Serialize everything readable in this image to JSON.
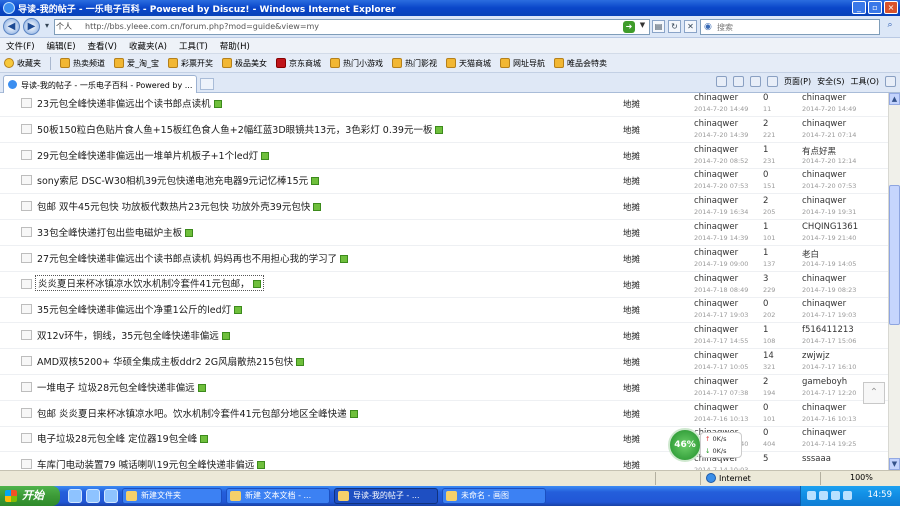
{
  "window": {
    "title": "导读-我的帖子 - 一乐电子百科 - Powered by Discuz! - Windows Internet Explorer"
  },
  "address": {
    "scheme_label": "个人",
    "url": "http://bbs.yleee.com.cn/forum.php?mod=guide&view=my"
  },
  "search": {
    "placeholder": "搜索"
  },
  "menu": [
    "文件(F)",
    "编辑(E)",
    "查看(V)",
    "收藏夹(A)",
    "工具(T)",
    "帮助(H)"
  ],
  "favorites": {
    "label": "收藏夹",
    "items": [
      "热卖频道",
      "爱_淘_宝",
      "彩票开奖",
      "极品美女",
      "京东商城",
      "热门小游戏",
      "热门影视",
      "天猫商城",
      "网址导航",
      "唯品会特卖"
    ]
  },
  "tab": {
    "label": "导读-我的帖子 - 一乐电子百科 - Powered by ..."
  },
  "commands": {
    "page": "页面(P)",
    "safety": "安全(S)",
    "tools": "工具(O)"
  },
  "threads": [
    {
      "title": "23元包全峰快递非偏远出个读书郎点读机",
      "forum": "地摊",
      "author": "chinaqwer",
      "adate": "2014-7-20 14:49",
      "replies": "0",
      "views": "11",
      "lastuser": "chinaqwer",
      "ldate": "2014-7-20 14:49"
    },
    {
      "title": "50板150粒白色贴片食人鱼+15板红色食人鱼+2幅红蓝3D眼镜共13元，3色彩灯 0.39元一板",
      "forum": "地摊",
      "author": "chinaqwer",
      "adate": "2014-7-20 14:39",
      "replies": "2",
      "views": "221",
      "lastuser": "chinaqwer",
      "ldate": "2014-7-21 07:14"
    },
    {
      "title": "29元包全峰快递非偏远出一堆单片机板子+1个led灯",
      "forum": "地摊",
      "author": "chinaqwer",
      "adate": "2014-7-20 08:52",
      "replies": "1",
      "views": "231",
      "lastuser": "有点好黑",
      "ldate": "2014-7-20 12:14"
    },
    {
      "title": "sony索尼 DSC-W30相机39元包快递电池充电器9元记忆棒15元",
      "forum": "地摊",
      "author": "chinaqwer",
      "adate": "2014-7-20 07:53",
      "replies": "0",
      "views": "151",
      "lastuser": "chinaqwer",
      "ldate": "2014-7-20 07:53"
    },
    {
      "title": "包邮 双牛45元包快 功放板代数热片23元包快 功放外壳39元包快",
      "forum": "地摊",
      "author": "chinaqwer",
      "adate": "2014-7-19 16:34",
      "replies": "2",
      "views": "205",
      "lastuser": "chinaqwer",
      "ldate": "2014-7-19 19:31"
    },
    {
      "title": "33包全峰快递打包出些电磁炉主板",
      "forum": "地摊",
      "author": "chinaqwer",
      "adate": "2014-7-19 14:39",
      "replies": "1",
      "views": "101",
      "lastuser": "CHQING1361",
      "ldate": "2014-7-19 21:40"
    },
    {
      "title": "27元包全峰快递非偏远出个读书郎点读机 妈妈再也不用担心我的学习了",
      "forum": "地摊",
      "author": "chinaqwer",
      "adate": "2014-7-19 09:00",
      "replies": "1",
      "views": "137",
      "lastuser": "老白",
      "ldate": "2014-7-19 14:05"
    },
    {
      "title": "炎炎夏日来杯冰镇凉水饮水机制冷套件41元包邮，",
      "forum": "地摊",
      "author": "chinaqwer",
      "adate": "2014-7-18 08:49",
      "replies": "3",
      "views": "229",
      "lastuser": "chinaqwer",
      "ldate": "2014-7-19 08:23"
    },
    {
      "title": "35元包全峰快递非偏远出个净重1公斤的led灯",
      "forum": "地摊",
      "author": "chinaqwer",
      "adate": "2014-7-17 19:03",
      "replies": "0",
      "views": "202",
      "lastuser": "chinaqwer",
      "ldate": "2014-7-17 19:03"
    },
    {
      "title": "双12v环牛，铜线，35元包全峰快递非偏远",
      "forum": "地摊",
      "author": "chinaqwer",
      "adate": "2014-7-17 14:55",
      "replies": "1",
      "views": "108",
      "lastuser": "f516411213",
      "ldate": "2014-7-17 15:06"
    },
    {
      "title": "AMD双核5200+ 华硕全集成主板ddr2 2G风扇散热215包快",
      "forum": "地摊",
      "author": "chinaqwer",
      "adate": "2014-7-17 10:05",
      "replies": "14",
      "views": "321",
      "lastuser": "zwjwjz",
      "ldate": "2014-7-17 16:10"
    },
    {
      "title": "一堆电子 垃圾28元包全峰快递非偏远",
      "forum": "地摊",
      "author": "chinaqwer",
      "adate": "2014-7-17 07:38",
      "replies": "2",
      "views": "194",
      "lastuser": "gameboyh",
      "ldate": "2014-7-17 12:20"
    },
    {
      "title": "包邮 炎炎夏日来杯冰镇凉水吧。饮水机制冷套件41元包部分地区全峰快递",
      "forum": "地摊",
      "author": "chinaqwer",
      "adate": "2014-7-16 10:13",
      "replies": "0",
      "views": "101",
      "lastuser": "chinaqwer",
      "ldate": "2014-7-16 10:13"
    },
    {
      "title": "电子垃圾28元包全峰 定位器19包全峰",
      "forum": "地摊",
      "author": "chinaqwer",
      "adate": "2014-7-16 12:40",
      "replies": "0",
      "views": "404",
      "lastuser": "chinaqwer",
      "ldate": "2014-7-14 19:25"
    },
    {
      "title": "车库门电动装置79 喊话喇叭19元包全峰快递非偏远",
      "forum": "地摊",
      "author": "chinaqwer",
      "adate": "2014-7-14 10:03",
      "replies": "5",
      "views": "",
      "lastuser": "sssaaa",
      "ldate": ""
    }
  ],
  "speed_widget": {
    "percent": "46%",
    "up": "0K/s",
    "down": "0K/s"
  },
  "statusbar": {
    "zone": "Internet",
    "zoom": "100%"
  },
  "taskbar": {
    "start": "开始",
    "buttons": [
      "新建文件夹",
      "新建 文本文档 - ...",
      "导读-我的帖子 - ...",
      "未命名 - 画图"
    ],
    "time": "14:59"
  }
}
